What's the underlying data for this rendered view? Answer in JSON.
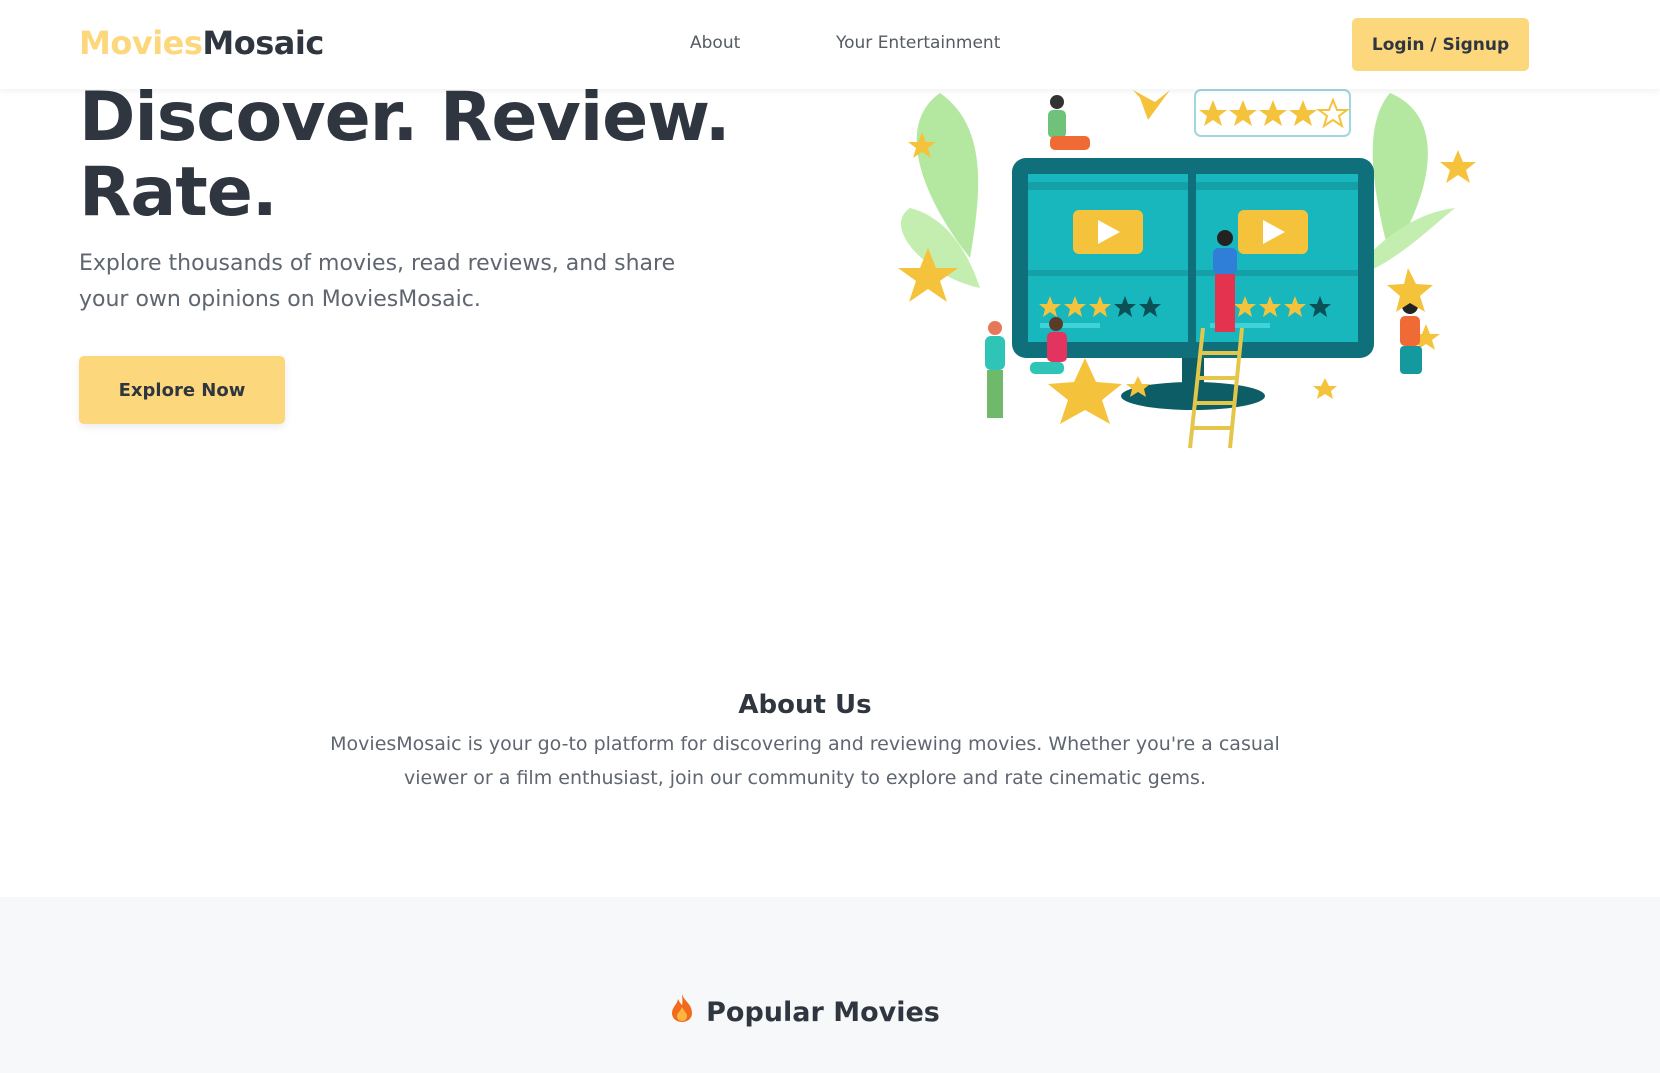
{
  "navbar": {
    "logo_part1": "Movies",
    "logo_part2": "Mosaic",
    "links": [
      {
        "label": "About"
      },
      {
        "label": "Your Entertainment"
      }
    ],
    "login_label": "Login / Signup"
  },
  "hero": {
    "title": "Discover. Review. Rate.",
    "subtitle": "Explore thousands of movies, read reviews, and share your own opinions on MoviesMosaic.",
    "cta_label": "Explore Now",
    "illustration_icon": "movie-review-illustration"
  },
  "about": {
    "title": "About Us",
    "text": "MoviesMosaic is your go-to platform for discovering and reviewing movies. Whether you're a casual viewer or a film enthusiast, join our community to explore and rate cinematic gems."
  },
  "popular": {
    "icon": "fire-icon",
    "title": "Popular Movies"
  },
  "colors": {
    "accent": "#fcd77c",
    "text_dark": "#2f3640",
    "text_muted": "#5f6670",
    "section_bg": "#f7f8fa"
  }
}
